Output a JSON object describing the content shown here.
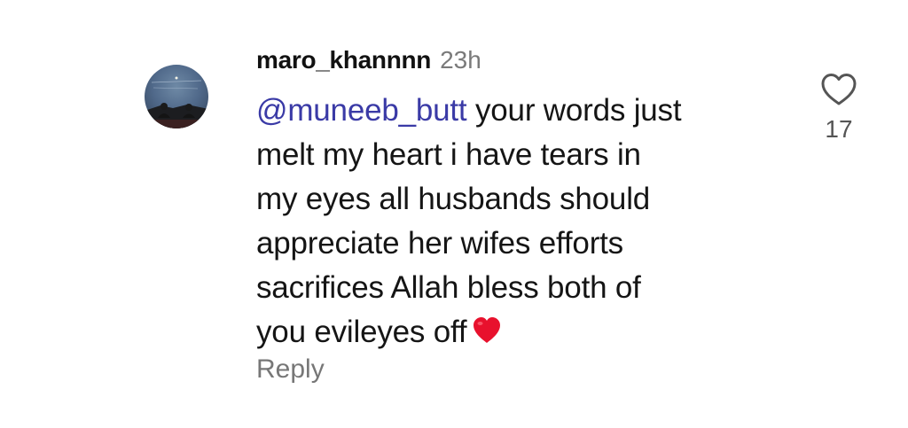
{
  "comment": {
    "username": "maro_khannnn",
    "timestamp": "23h",
    "mention": "@muneeb_butt",
    "lines": [
      " your words just",
      "melt my heart i have tears in",
      "my eyes all husbands should",
      "appreciate her wifes efforts",
      "sacrifices Allah bless both of",
      "you evileyes off"
    ],
    "emoji": "red-heart-emoji",
    "reply_label": "Reply",
    "like_icon": "heart-outline-icon",
    "like_count": "17"
  },
  "colors": {
    "mention": "#3a3aa6",
    "timestamp": "#7a7a7a",
    "reply": "#777777",
    "emoji_heart": "#e8112d"
  }
}
